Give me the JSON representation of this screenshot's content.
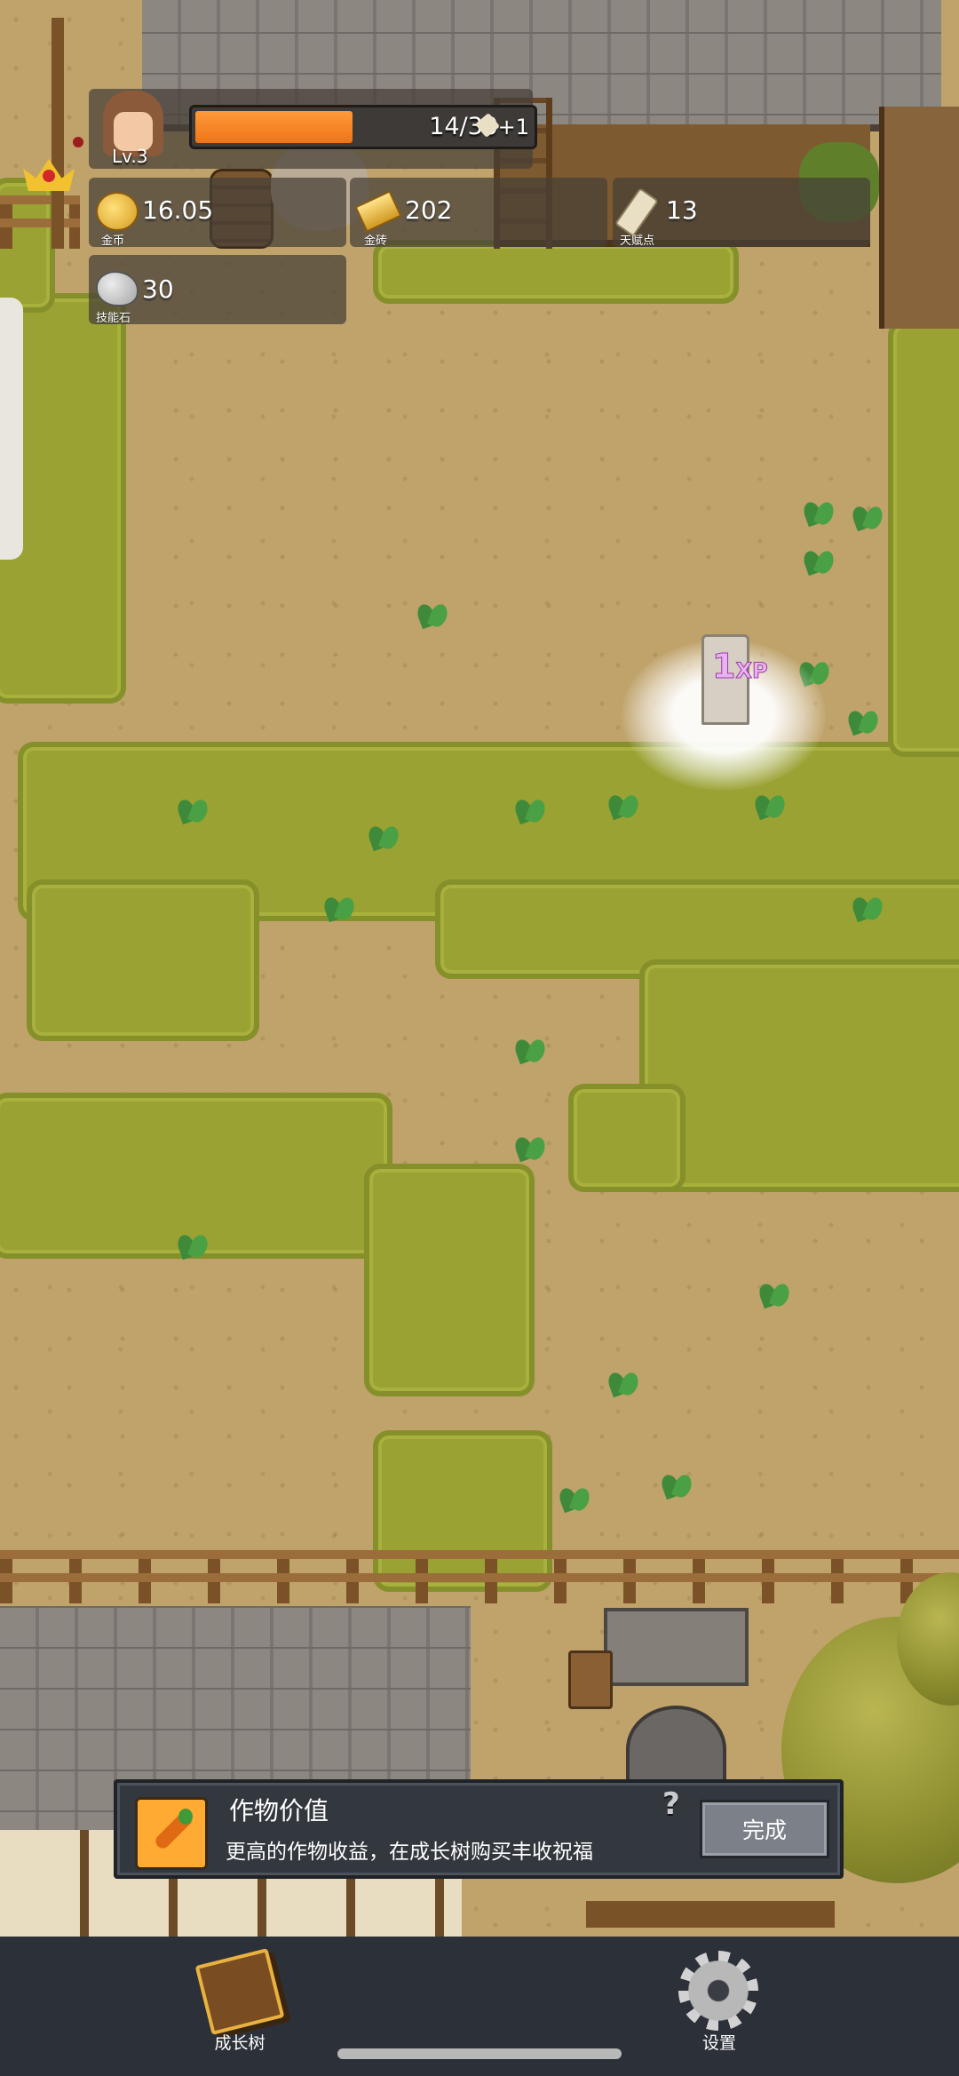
{
  "player": {
    "level": "Lv.3",
    "exp_text": "14/30",
    "exp_fraction": 0.467,
    "exp_bonus": "+1"
  },
  "currencies": [
    {
      "value": "16.05",
      "caption": "金币",
      "icon": "gold-coin-icon"
    },
    {
      "value": "202",
      "caption": "金砖",
      "icon": "gold-brick-icon"
    },
    {
      "value": "13",
      "caption": "天赋点",
      "icon": "talent-scroll-icon"
    },
    {
      "value": "30",
      "caption": "技能石",
      "icon": "skill-stone-icon"
    }
  ],
  "popup": {
    "amount": "1",
    "unit": "XP"
  },
  "quest": {
    "title": "作物价值",
    "description": "更高的作物收益，在成长树购买丰收祝福",
    "help": "?",
    "done_label": "完成",
    "icon": "carrot-icon"
  },
  "nav": [
    {
      "label": "成长树",
      "icon": "growth-book-icon"
    },
    {
      "label": "设置",
      "icon": "gear-icon"
    }
  ],
  "colors": {
    "exp_fill": "#ee7417",
    "panel": "#33373e",
    "bottom_bar": "#2c3038"
  }
}
